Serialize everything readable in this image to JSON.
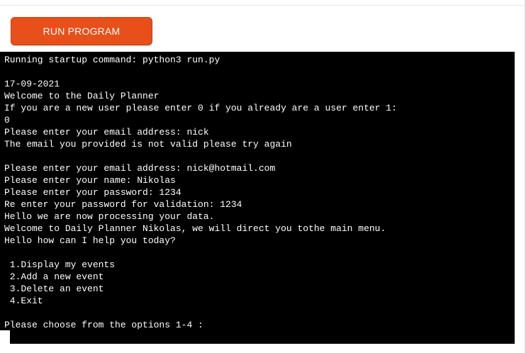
{
  "toolbar": {
    "run_label": "RUN PROGRAM"
  },
  "colors": {
    "run_button": "#e8501b",
    "terminal_background": "#000000",
    "terminal_text": "#ffffff"
  },
  "terminal": {
    "lines": [
      "Running startup command: python3 run.py",
      "",
      "17-09-2021",
      "Welcome to the Daily Planner",
      "If you are a new user please enter 0 if you already are a user enter 1:",
      "0",
      "Please enter your email address: nick",
      "The email you provided is not valid please try again",
      "",
      "Please enter your email address: nick@hotmail.com",
      "Please enter your name: Nikolas",
      "Please enter your password: 1234",
      "Re enter your password for validation: 1234",
      "Hello we are now processing your data.",
      "Welcome to Daily Planner Nikolas, we will direct you tothe main menu.",
      "Hello how can I help you today?",
      "",
      " 1.Display my events",
      " 2.Add a new event",
      " 3.Delete an event",
      " 4.Exit",
      "",
      "Please choose from the options 1-4 : "
    ]
  }
}
